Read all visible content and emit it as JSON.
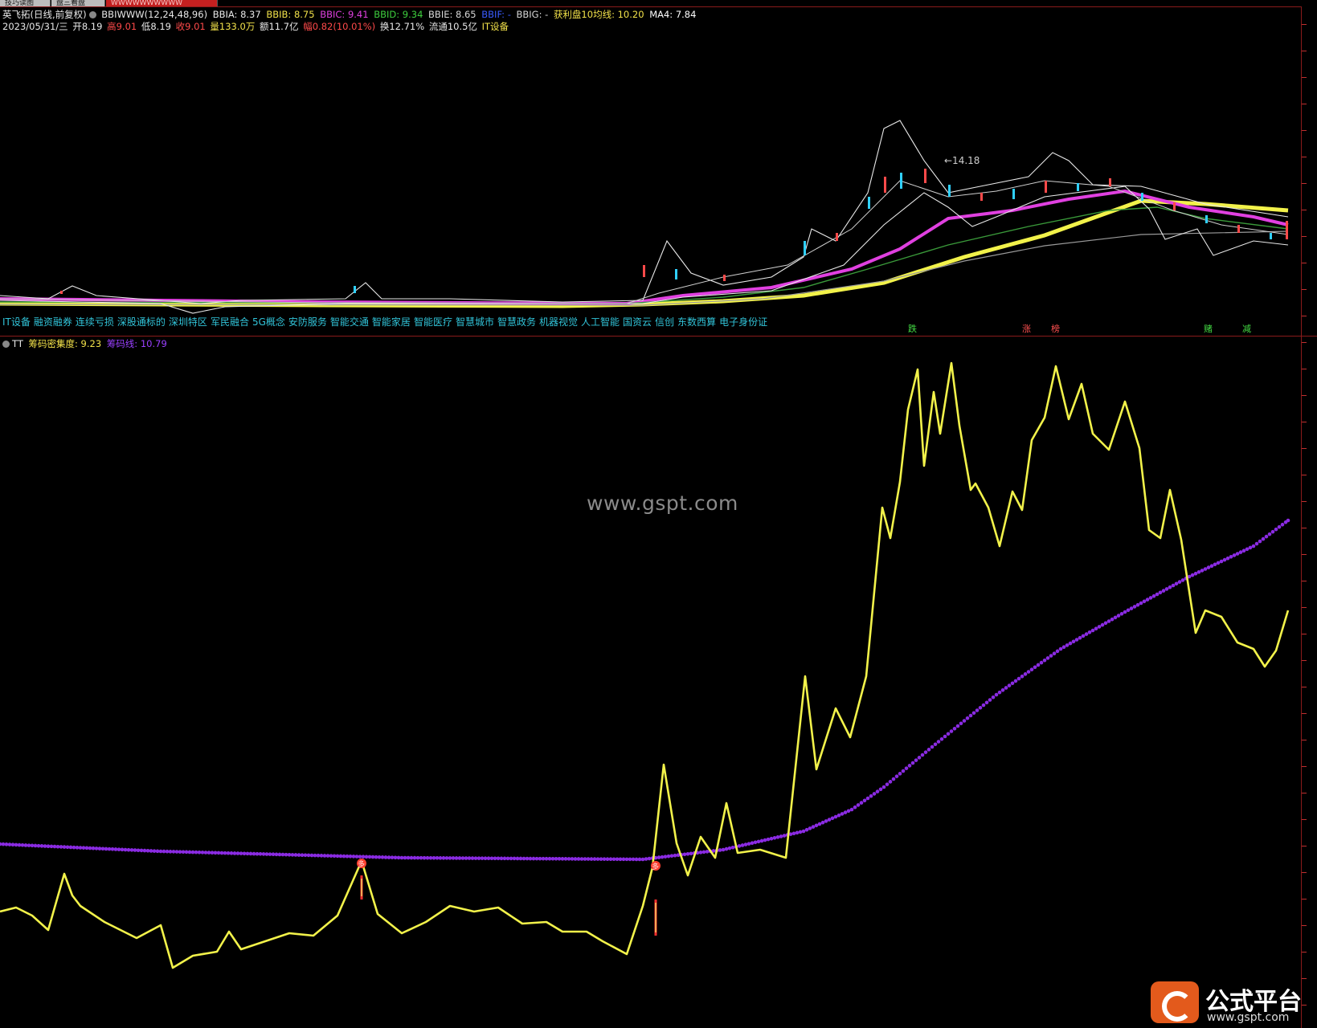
{
  "tabs": [
    {
      "label": "技巧读图",
      "active": false
    },
    {
      "label": "盘三看盘",
      "active": false
    },
    {
      "label": "WWWWWWWWWW",
      "active": true
    }
  ],
  "main_header": [
    {
      "text": "英飞拓(日线,前复权)",
      "color": "#e8e8e8"
    },
    {
      "text": "BBIWWW(12,24,48,96)",
      "color": "#e8e8e8"
    },
    {
      "text": "BBIA: 8.37",
      "color": "#e8e8e8"
    },
    {
      "text": "BBIB: 8.75",
      "color": "#f2e24a"
    },
    {
      "text": "BBIC: 9.41",
      "color": "#e040e0"
    },
    {
      "text": "BBID: 9.34",
      "color": "#3ecf3e"
    },
    {
      "text": "BBIE: 8.65",
      "color": "#d8d8d8"
    },
    {
      "text": "BBIF: -",
      "color": "#3a5cff"
    },
    {
      "text": "BBIG: -",
      "color": "#d8d8d8"
    },
    {
      "text": "获利盘10均线: 10.20",
      "color": "#f2e24a"
    },
    {
      "text": "MA4: 7.84",
      "color": "#ffffff"
    }
  ],
  "info_line": [
    {
      "text": "2023/05/31/三",
      "color": "#e8e8e8"
    },
    {
      "text": "开8.19",
      "color": "#e8e8e8"
    },
    {
      "text": "高9.01",
      "color": "#ff4a4a"
    },
    {
      "text": "低8.19",
      "color": "#e8e8e8"
    },
    {
      "text": "收9.01",
      "color": "#ff4a4a"
    },
    {
      "text": "量133.0万",
      "color": "#f2e24a"
    },
    {
      "text": "额11.7亿",
      "color": "#e8e8e8"
    },
    {
      "text": "幅0.82(10.01%)",
      "color": "#ff4a4a"
    },
    {
      "text": "换12.71%",
      "color": "#e8e8e8"
    },
    {
      "text": "流通10.5亿",
      "color": "#e8e8e8"
    },
    {
      "text": "IT设备",
      "color": "#f2e24a"
    }
  ],
  "sectors": [
    "IT设备",
    "融资融券",
    "连续亏损",
    "深股通标的",
    "深圳特区",
    "军民融合",
    "5G概念",
    "安防服务",
    "智能交通",
    "智能家居",
    "智能医疗",
    "智慧城市",
    "智慧政务",
    "机器视觉",
    "人工智能",
    "国资云",
    "信创",
    "东数西算",
    "电子身份证"
  ],
  "markers": [
    {
      "text": "跌",
      "color": "#44dd44"
    },
    {
      "text": "涨",
      "color": "#ff5050"
    },
    {
      "text": "榜",
      "color": "#ff5050"
    },
    {
      "text": "赌",
      "color": "#44dd44"
    },
    {
      "text": "减",
      "color": "#44dd44"
    }
  ],
  "price_annotation": "14.18",
  "sub_header": [
    {
      "text": "TT",
      "color": "#e8e8e8"
    },
    {
      "text": "筹码密集度: 9.23",
      "color": "#f2e24a"
    },
    {
      "text": "筹码线: 10.79",
      "color": "#9a40ff"
    }
  ],
  "signal_label": "多",
  "watermark": "www.gspt.com",
  "brand": {
    "name": "公式平台",
    "url": "www.gspt.com"
  },
  "colors": {
    "yellow": "#f2f24a",
    "purple": "#8a2be2",
    "magenta": "#e040e0",
    "green": "#3a9a3a",
    "white": "#e8e8e8",
    "red": "#ff3030",
    "cyan": "#31c3d8"
  }
}
